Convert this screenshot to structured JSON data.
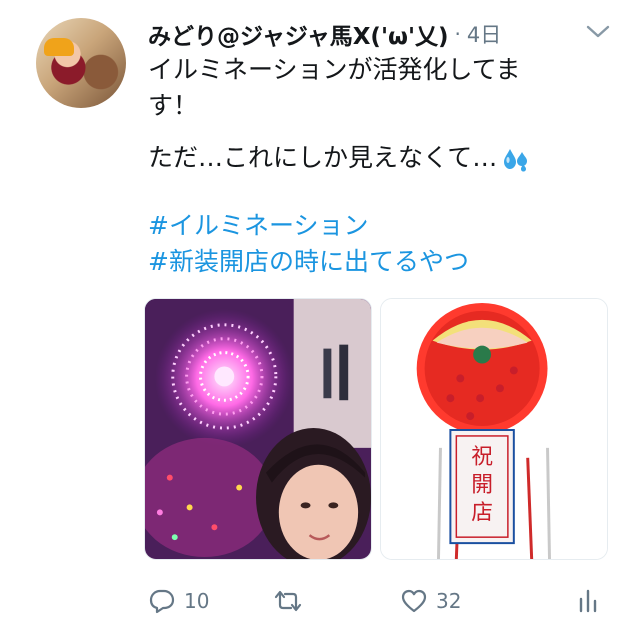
{
  "tweet": {
    "display_name": "みどり@ジャジャ馬X('ω'乂)",
    "separator": "·",
    "time": "4日",
    "text_line1": "イルミネーションが活発化してま",
    "text_line2": "す！",
    "text_line3": "ただ…これにしか見えなくて…",
    "emoji": "sweat-droplets",
    "hashtag1": "#イルミネーション",
    "hashtag2": "#新装開店の時に出てるやつ",
    "replies": "10",
    "retweets": "",
    "likes": "32"
  },
  "colors": {
    "link": "#1b95e0",
    "text": "#14171a",
    "muted": "#657786"
  },
  "media": {
    "image1": "selfie-with-illumination-photo",
    "image2": "grand-opening-flower-stand-photo",
    "sign_text": "祝開店"
  }
}
